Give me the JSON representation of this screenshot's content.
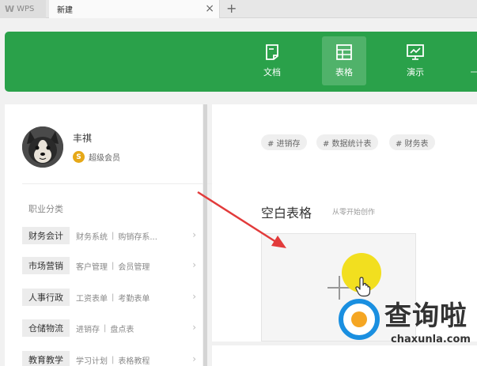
{
  "tabbar": {
    "wps_label": "WPS",
    "new_tab_label": "新建",
    "close_glyph": "×",
    "add_glyph": "+"
  },
  "doc_types": [
    {
      "label": "文档",
      "icon": "document-icon",
      "active": false
    },
    {
      "label": "表格",
      "icon": "spreadsheet-icon",
      "active": true
    },
    {
      "label": "演示",
      "icon": "presentation-icon",
      "active": false
    }
  ],
  "user": {
    "name": "丰祺",
    "membership": "超级会员",
    "badge_glyph": "S"
  },
  "categories": {
    "title": "职业分类",
    "items": [
      {
        "label": "财务会计",
        "subs": [
          "财务系统",
          "购销存系..."
        ]
      },
      {
        "label": "市场营销",
        "subs": [
          "客户管理",
          "会员管理"
        ]
      },
      {
        "label": "人事行政",
        "subs": [
          "工资表单",
          "考勤表单"
        ]
      },
      {
        "label": "仓储物流",
        "subs": [
          "进销存",
          "盘点表"
        ]
      },
      {
        "label": "教育教学",
        "subs": [
          "学习计划",
          "表格教程"
        ]
      }
    ]
  },
  "tags": [
    "# 进销存",
    "# 数据统计表",
    "# 财务表"
  ],
  "blank_section": {
    "title": "空白表格",
    "subtitle": "从零开始创作"
  },
  "watermark": {
    "text": "查询啦",
    "url": "chaxunla.com"
  },
  "colors": {
    "banner_green": "#2aa14a",
    "arrow_red": "#e23b3b",
    "cursor_yellow": "#f2df1f"
  }
}
